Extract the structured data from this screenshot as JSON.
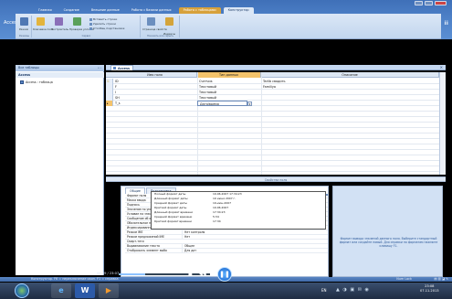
{
  "window": {
    "app_title": "Access"
  },
  "ribbon": {
    "tabs": [
      "Главная",
      "Создание",
      "Внешние данные",
      "Работа с базами данных",
      "Работа с таблицами",
      "Конструктор"
    ],
    "groups": {
      "views": {
        "label": "Режимы",
        "button": "Режим"
      },
      "tools": {
        "label": "Сервис",
        "buttons": [
          "Ключевое поле",
          "Построитель",
          "Проверка условий"
        ],
        "small": [
          "Вставить строки",
          "Удалить строки",
          "Столбец подстановок"
        ]
      },
      "show": {
        "label": "Показать или скрыть",
        "buttons": [
          "Страница свойств",
          "Индексы"
        ]
      }
    }
  },
  "nav": {
    "header": "Все таблицы",
    "header_ctrls": "« ‹",
    "group": "Access",
    "item": "Access : таблица"
  },
  "document": {
    "tab": "Access"
  },
  "grid": {
    "headers": [
      "Имя поля",
      "Тип данных",
      "Описание"
    ],
    "rows": [
      {
        "name": "ID",
        "type": "Счетчик",
        "desc": "Tarlib сводить"
      },
      {
        "name": "F",
        "type": "Текстовый",
        "desc": "Familiya"
      },
      {
        "name": "I",
        "type": "Текстовый",
        "desc": ""
      },
      {
        "name": "SH",
        "type": "Текстовый",
        "desc": ""
      },
      {
        "name": "T_s",
        "type": "Дата/время",
        "desc": ""
      }
    ]
  },
  "properties": {
    "title": "Свойства поля",
    "tabs": [
      "Общие",
      "Подстановка"
    ],
    "rows": [
      {
        "label": "Формат поля",
        "value": ""
      },
      {
        "label": "Маска ввода",
        "value": ""
      },
      {
        "label": "Подпись",
        "value": ""
      },
      {
        "label": "Значение по умолчанию",
        "value": ""
      },
      {
        "label": "Условие на значение",
        "value": ""
      },
      {
        "label": "Сообщение об ошибке",
        "value": ""
      },
      {
        "label": "Обязательное поле",
        "value": ""
      },
      {
        "label": "Индексированное поле",
        "value": ""
      },
      {
        "label": "Режим IME",
        "value": "Нет контроля"
      },
      {
        "label": "Режим предложений IME",
        "value": "Нет"
      },
      {
        "label": "Смарт-теги",
        "value": ""
      },
      {
        "label": "Выравнивание текста",
        "value": "Общее"
      },
      {
        "label": "Отображать элемент выбо",
        "value": "Для дат"
      }
    ],
    "format_options": [
      {
        "name": "Полный формат даты",
        "sample": "19.06.2007 17:34:23"
      },
      {
        "name": "Длинный формат даты",
        "sample": "19 июня 2007 г."
      },
      {
        "name": "Средний формат даты",
        "sample": "19-июн-2007"
      },
      {
        "name": "Краткий формат даты",
        "sample": "19.06.2007"
      },
      {
        "name": "Длинный формат времени",
        "sample": "17:34:23"
      },
      {
        "name": "Средний формат времени",
        "sample": "5:34"
      },
      {
        "name": "Краткий формат времени",
        "sample": "17:34"
      }
    ],
    "help": "Формат вывода значений данного поля. Выберите стандартный формат или создайте новый. Для справки по форматам нажмите клавишу F1."
  },
  "status": {
    "left": "Конструктор. F6 = переключение окон. F1 = справка",
    "right": "Num Lock",
    "icons": "▤ ▥ ◪ ✎"
  },
  "player": {
    "time": "06:39 / 23:07",
    "progress": 0.29,
    "buttons": {
      "stop": "■",
      "prev": "◀◀",
      "next": "▶▶",
      "mute": "◀)",
      "pause": "❚❚"
    }
  },
  "taskbar": {
    "apps": [
      "e",
      "W",
      "▶"
    ],
    "lang": "EN",
    "tray": "▲ ◑ ▣ ✉ ◉",
    "time": "23:08",
    "date": "07.11.2013"
  },
  "colors": {
    "frame": "#4d80c7",
    "ribbon": "#dbe7f6",
    "selected_header": "#f4c36b",
    "taskbar": "#1f2c42"
  }
}
